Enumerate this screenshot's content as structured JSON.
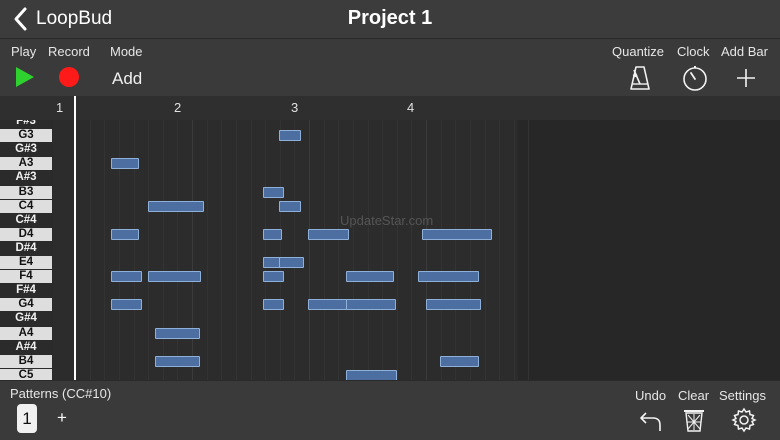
{
  "header": {
    "back_label": "LoopBud",
    "title": "Project 1"
  },
  "toolbar": {
    "play_label": "Play",
    "record_label": "Record",
    "mode_label": "Mode",
    "mode_value": "Add",
    "quantize_label": "Quantize",
    "clock_label": "Clock",
    "add_bar_label": "Add Bar"
  },
  "ruler": {
    "bars": [
      "1",
      "2",
      "3",
      "4"
    ]
  },
  "keys": [
    "F#3",
    "G3",
    "G#3",
    "A3",
    "A#3",
    "B3",
    "C4",
    "C#4",
    "D4",
    "D#4",
    "E4",
    "F4",
    "F#4",
    "G4",
    "G#4",
    "A4",
    "A#4",
    "B4",
    "C5"
  ],
  "notes": [
    {
      "pitch": "G3",
      "start": 2.74,
      "end": 2.93
    },
    {
      "pitch": "A3",
      "start": 1.31,
      "end": 1.55
    },
    {
      "pitch": "B3",
      "start": 2.61,
      "end": 2.79
    },
    {
      "pitch": "C4",
      "start": 1.62,
      "end": 2.1
    },
    {
      "pitch": "C4",
      "start": 2.74,
      "end": 2.93
    },
    {
      "pitch": "D4",
      "start": 1.31,
      "end": 1.55
    },
    {
      "pitch": "D4",
      "start": 2.61,
      "end": 2.77
    },
    {
      "pitch": "D4",
      "start": 2.99,
      "end": 3.34
    },
    {
      "pitch": "D4",
      "start": 3.97,
      "end": 4.56
    },
    {
      "pitch": "E4",
      "start": 2.61,
      "end": 2.77
    },
    {
      "pitch": "E4",
      "start": 2.74,
      "end": 2.96
    },
    {
      "pitch": "F4",
      "start": 1.31,
      "end": 1.57
    },
    {
      "pitch": "F4",
      "start": 1.62,
      "end": 2.08
    },
    {
      "pitch": "F4",
      "start": 2.61,
      "end": 2.79
    },
    {
      "pitch": "F4",
      "start": 3.32,
      "end": 3.73
    },
    {
      "pitch": "F4",
      "start": 3.93,
      "end": 4.45
    },
    {
      "pitch": "G4",
      "start": 1.31,
      "end": 1.57
    },
    {
      "pitch": "G4",
      "start": 2.61,
      "end": 2.79
    },
    {
      "pitch": "G4",
      "start": 2.99,
      "end": 3.34
    },
    {
      "pitch": "G4",
      "start": 3.32,
      "end": 3.74
    },
    {
      "pitch": "G4",
      "start": 4.0,
      "end": 4.47
    },
    {
      "pitch": "A4",
      "start": 1.68,
      "end": 2.07
    },
    {
      "pitch": "B4",
      "start": 1.68,
      "end": 2.07
    },
    {
      "pitch": "B4",
      "start": 4.12,
      "end": 4.45
    },
    {
      "pitch": "C5",
      "start": 3.32,
      "end": 3.75
    }
  ],
  "watermark": "UpdateStar.com",
  "bottom": {
    "patterns_label": "Patterns (CC#10)",
    "pattern_number": "1",
    "pattern_add": "+",
    "undo_label": "Undo",
    "clear_label": "Clear",
    "settings_label": "Settings"
  },
  "colors": {
    "play": "#2fd12f",
    "record": "#ff1a1a",
    "note_fill": "#4c6ea0",
    "note_border": "#8fb0d8"
  },
  "icons": {
    "back": "chevron-left-icon",
    "play": "play-icon",
    "record": "record-icon",
    "quantize": "metronome-icon",
    "clock": "stopwatch-icon",
    "add_bar": "plus-icon",
    "undo": "undo-icon",
    "clear": "trash-icon",
    "settings": "gear-icon"
  }
}
